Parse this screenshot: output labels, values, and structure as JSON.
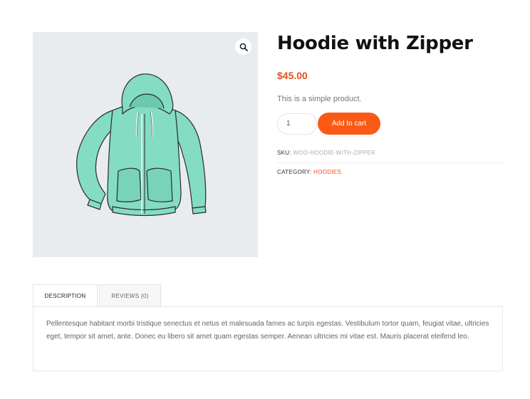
{
  "product": {
    "title": "Hoodie with Zipper",
    "price": "$45.00",
    "short_description": "This is a simple product.",
    "quantity": "1",
    "add_to_cart_label": "Add to cart",
    "sku_label": "SKU:",
    "sku_value": "WOO-HOODIE-WITH-ZIPPER",
    "category_label": "CATEGORY:",
    "category_value": "HOODIES"
  },
  "gallery": {
    "zoom_icon": "magnifier-icon",
    "image_subject": "hoodie"
  },
  "tabs": [
    {
      "label": "DESCRIPTION",
      "active": true
    },
    {
      "label": "REVIEWS (0)",
      "active": false
    }
  ],
  "description": {
    "text": "Pellentesque habitant morbi tristique senectus et netus et malesuada fames ac turpis egestas. Vestibulum tortor quam, feugiat vitae, ultricies eget, tempor sit amet, ante. Donec eu libero sit amet quam egestas semper. Aenean ultricies mi vitae est. Mauris placerat eleifend leo."
  },
  "colors": {
    "accent": "#fb5a16",
    "price": "#e8501e",
    "hoodie": "#7fd8c0",
    "gallery_bg": "#e9ecef"
  }
}
